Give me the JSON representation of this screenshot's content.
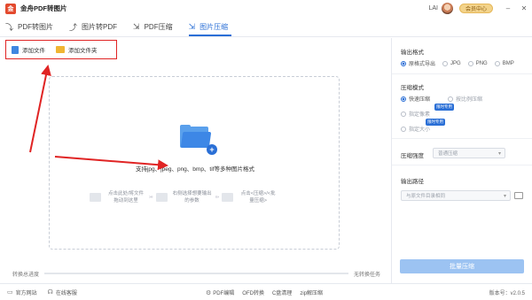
{
  "app": {
    "title": "金舟PDF转图片",
    "logo_text": "金"
  },
  "titlebar": {
    "user": "LAI",
    "vip_label": "会员中心",
    "minimize": "–",
    "close": "✕"
  },
  "tabs": [
    {
      "label": "PDF转图片",
      "icon": "pdf-to-image-icon",
      "glyph": "⤵"
    },
    {
      "label": "图片转PDF",
      "icon": "image-to-pdf-icon",
      "glyph": "⤴"
    },
    {
      "label": "PDF压缩",
      "icon": "pdf-compress-icon",
      "glyph": "⇲"
    },
    {
      "label": "图片压缩",
      "icon": "image-compress-icon",
      "glyph": "⇲",
      "active": true
    }
  ],
  "actions": {
    "add_file": "添加文件",
    "add_folder": "添加文件夹"
  },
  "dropzone": {
    "hint": "支持jpg、jpeg、png、bmp、tif等多种图片格式",
    "step1": "点击此处/将文件拖动到这里",
    "step2": "右侧选择想要输出的参数",
    "step3": "点击<压缩>/<批量压缩>",
    "sep": "› › ›"
  },
  "progress": {
    "left": "转换总进度",
    "right": "无转换任务",
    "value": 0
  },
  "settings": {
    "output_format_label": "输出格式",
    "formats": [
      "原格式导出",
      "JPG",
      "PNG",
      "BMP"
    ],
    "selected_format": "原格式导出",
    "compress_mode_label": "压缩模式",
    "modes": [
      "快速压缩",
      "按比例压缩",
      "指定像素",
      "指定大小"
    ],
    "selected_mode": "快速压缩",
    "badge_pixel": "限时专用",
    "badge_size": "限时专用",
    "compress_strength_label": "压缩强度",
    "compress_strength_value": "普通压缩",
    "output_path_label": "输出路径",
    "output_path_value": "与原文件目录相同",
    "batch_button": "批量压缩"
  },
  "footer": {
    "website": "官方网站",
    "service": "在线客服",
    "pdf_edit": "PDF编辑",
    "ofd_convert": "OFD转换",
    "c_clean": "C盘清理",
    "zip": "zip解压缩",
    "version": "版本号：v2.0.5"
  },
  "colors": {
    "accent": "#2a6fd6",
    "highlight_border": "#e02424",
    "annotation_arrow": "#e02424"
  }
}
